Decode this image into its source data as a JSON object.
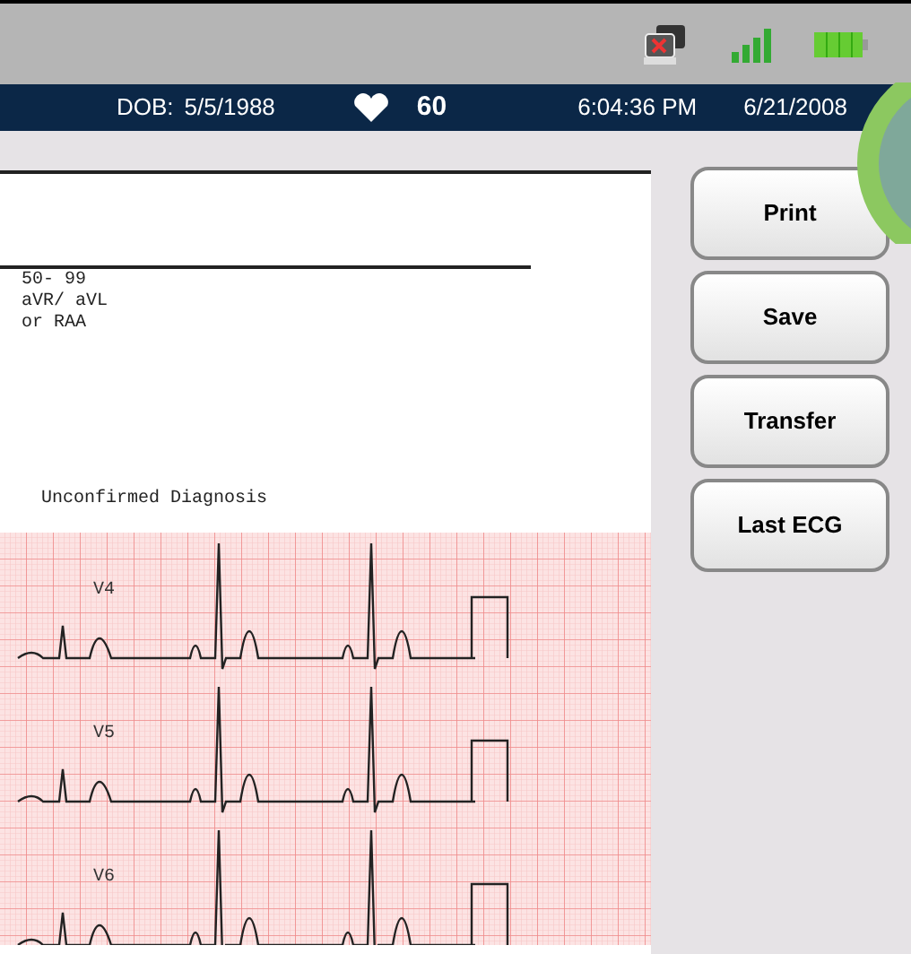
{
  "patient_bar": {
    "dob_label": "DOB:",
    "dob": "5/5/1988",
    "heart_rate": "60",
    "time": "6:04:36 PM",
    "date": "6/21/2008"
  },
  "report": {
    "lines": [
      "50- 99",
      "aVR/ aVL",
      "or RAA"
    ],
    "diagnosis": "Unconfirmed Diagnosis"
  },
  "leads": [
    {
      "label": "V4"
    },
    {
      "label": "V5"
    },
    {
      "label": "V6"
    }
  ],
  "buttons": [
    "Print",
    "Save",
    "Transfer",
    "Last ECG"
  ]
}
